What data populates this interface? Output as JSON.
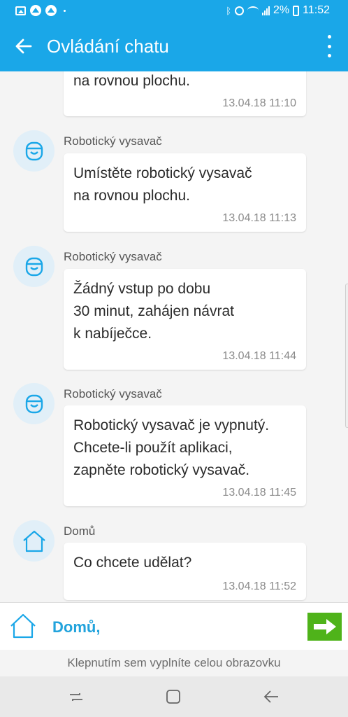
{
  "status_bar": {
    "battery_text": "2%",
    "time": "11:52",
    "left_icons": [
      "gallery-icon",
      "app-icon",
      "app-icon",
      "dot-icon"
    ],
    "right_icons": [
      "bluetooth-icon",
      "alarm-icon",
      "wifi-icon",
      "signal-icon",
      "battery-icon"
    ]
  },
  "app_bar": {
    "title": "Ovládání chatu",
    "back_icon": "arrow-left-icon",
    "menu_icon": "more-vertical-icon"
  },
  "messages": [
    {
      "text": "na rovnou plochu.",
      "time": "13.04.18 11:10"
    },
    {
      "sender": "Robotický vysavač",
      "avatar_icon": "robot-vacuum-icon",
      "text": "Umístěte robotický vysavač\nna rovnou plochu.",
      "time": "13.04.18 11:13"
    },
    {
      "sender": "Robotický vysavač",
      "avatar_icon": "robot-vacuum-icon",
      "text": "Žádný vstup po dobu\n30 minut, zahájen návrat\nk nabíječce.",
      "time": "13.04.18 11:44"
    },
    {
      "sender": "Robotický vysavač",
      "avatar_icon": "robot-vacuum-icon",
      "text": "Robotický vysavač je vypnutý.\nChcete-li použít aplikaci,\nzapněte robotický vysavač.",
      "time": "13.04.18 11:45"
    },
    {
      "sender": "Domů",
      "avatar_icon": "home-icon",
      "text": "Co chcete udělat?",
      "time": "13.04.18 11:52"
    }
  ],
  "input_bar": {
    "label": "Domů,",
    "home_icon": "home-icon",
    "send_icon": "arrow-right-icon"
  },
  "hint_text": "Klepnutím sem vyplníte celou obrazovku",
  "nav_bar": {
    "icons": [
      "recent-apps-icon",
      "home-button-icon",
      "back-icon"
    ]
  },
  "colors": {
    "primary": "#1aa7e8",
    "accent_text": "#22a3dc",
    "send_button": "#4fb31a",
    "avatar_bg": "#e1eff8"
  }
}
